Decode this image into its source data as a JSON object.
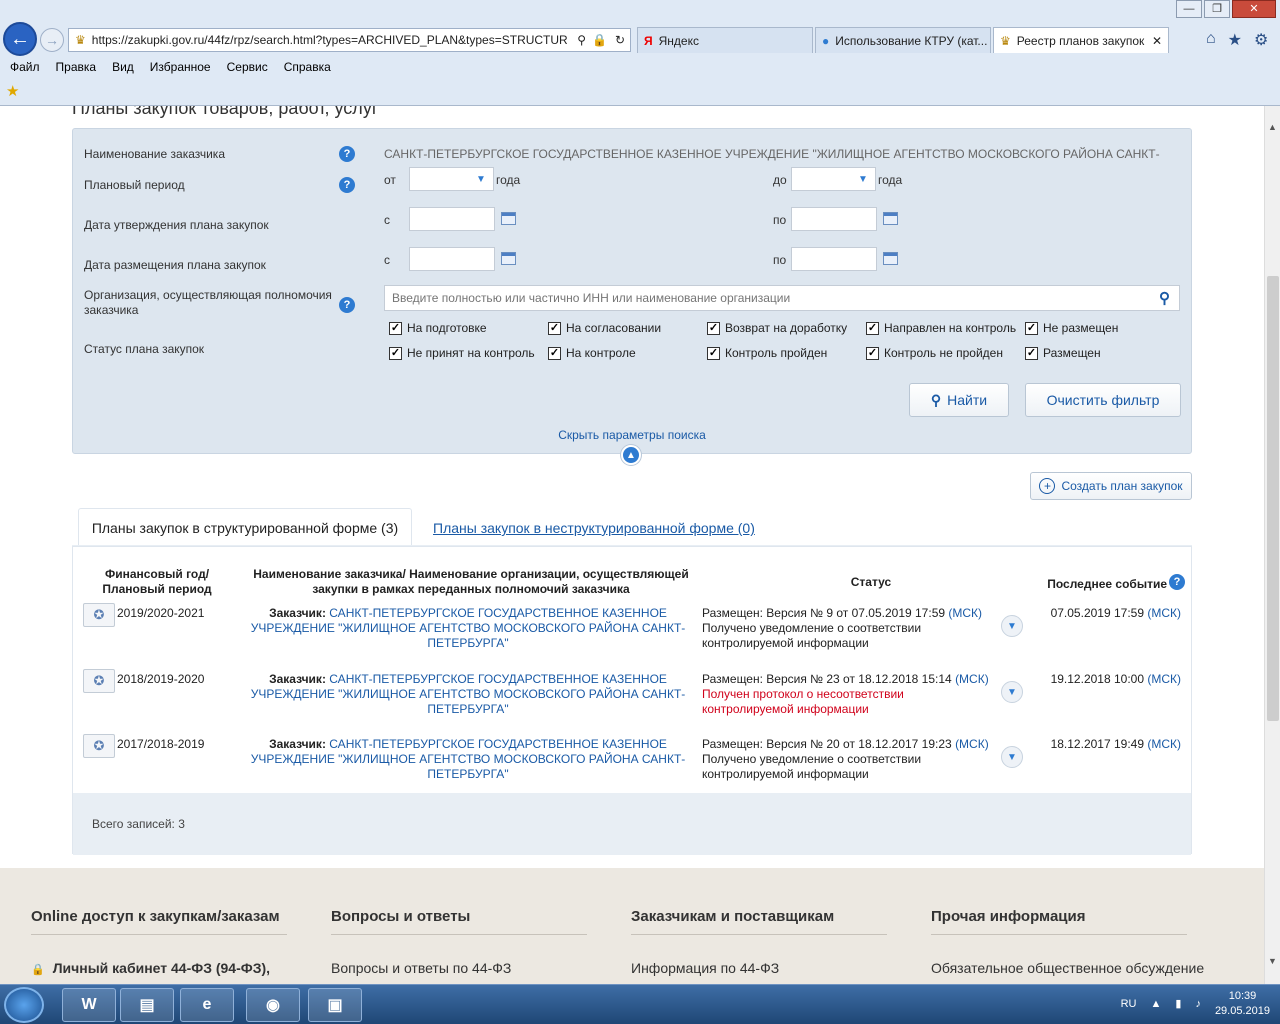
{
  "browser": {
    "url": "https://zakupki.gov.ru/44fz/rpz/search.html?types=ARCHIVED_PLAN&types=STRUCTUR",
    "tabs": [
      {
        "label": "Яндекс"
      },
      {
        "label": "Использование КТРУ (кат..."
      },
      {
        "label": "Реестр планов закупок"
      }
    ],
    "menu": [
      "Файл",
      "Правка",
      "Вид",
      "Избранное",
      "Сервис",
      "Справка"
    ]
  },
  "page": {
    "heading": "Планы закупок товаров, работ, услуг"
  },
  "filter": {
    "customer_label": "Наименование заказчика",
    "customer_value": "САНКТ-ПЕТЕРБУРГСКОЕ ГОСУДАРСТВЕННОЕ КАЗЕННОЕ УЧРЕЖДЕНИЕ \"ЖИЛИЩНОЕ АГЕНТСТВО МОСКОВСКОГО РАЙОНА САНКТ-",
    "period_label": "Плановый период",
    "from_word": "от",
    "to_word": "до",
    "year_word": "года",
    "approval_label": "Дата утверждения плана закупок",
    "posting_label": "Дата размещения плана закупок",
    "c_word": "с",
    "po_word": "по",
    "org_label": "Организация, осуществляющая полномочия заказчика",
    "org_placeholder": "Введите полностью или частично ИНН или наименование организации",
    "status_label": "Статус плана закупок",
    "statuses": [
      "На подготовке",
      "На согласовании",
      "Возврат на доработку",
      "Направлен на контроль",
      "Не размещен",
      "Не принят на контроль",
      "На контроле",
      "Контроль пройден",
      "Контроль не пройден",
      "Размещен"
    ],
    "find_button": "Найти",
    "clear_button": "Очистить фильтр",
    "hide_link": "Скрыть параметры поиска"
  },
  "create_plan": "Создать план закупок",
  "tabs": {
    "structured": "Планы закупок в структурированной форме (3)",
    "unstructured": "Планы закупок в неструктурированной форме (0)"
  },
  "table": {
    "headers": {
      "year": "Финансовый год/ Плановый период",
      "customer": "Наименование заказчика/ Наименование организации, осуществляющей закупки в рамках переданных полномочий заказчика",
      "status": "Статус",
      "last_event": "Последнее событие"
    },
    "customer_prefix": "Заказчик:",
    "rows": [
      {
        "year": "2019/2020-2021",
        "customer": "САНКТ-ПЕТЕРБУРГСКОЕ ГОСУДАРСТВЕННОЕ КАЗЕННОЕ УЧРЕЖДЕНИЕ \"ЖИЛИЩНОЕ АГЕНТСТВО МОСКОВСКОГО РАЙОНА САНКТ-ПЕТЕРБУРГА\"",
        "status_main": "Размещен: Версия № 9 от 07.05.2019 17:59",
        "status_note": "Получено уведомление о соответствии контролируемой информации",
        "note_color": "#222222",
        "last_event": "07.05.2019 17:59"
      },
      {
        "year": "2018/2019-2020",
        "customer": "САНКТ-ПЕТЕРБУРГСКОЕ ГОСУДАРСТВЕННОЕ КАЗЕННОЕ УЧРЕЖДЕНИЕ \"ЖИЛИЩНОЕ АГЕНТСТВО МОСКОВСКОГО РАЙОНА САНКТ-ПЕТЕРБУРГА\"",
        "status_main": "Размещен: Версия № 23 от 18.12.2018 15:14",
        "status_note": "Получен протокол о несоответствии контролируемой информации",
        "note_color": "#d0021b",
        "last_event": "19.12.2018 10:00"
      },
      {
        "year": "2017/2018-2019",
        "customer": "САНКТ-ПЕТЕРБУРГСКОЕ ГОСУДАРСТВЕННОЕ КАЗЕННОЕ УЧРЕЖДЕНИЕ \"ЖИЛИЩНОЕ АГЕНТСТВО МОСКОВСКОГО РАЙОНА САНКТ-ПЕТЕРБУРГА\"",
        "status_main": "Размещен: Версия № 20 от 18.12.2017 19:23",
        "status_note": "Получено уведомление о соответствии контролируемой информации",
        "note_color": "#222222",
        "last_event": "18.12.2017 19:49"
      }
    ],
    "msk": "(МСК)",
    "total": "Всего записей: 3"
  },
  "footer": {
    "columns": [
      {
        "title": "Online доступ к закупкам/заказам",
        "item": "Личный кабинет 44-ФЗ (94-ФЗ),"
      },
      {
        "title": "Вопросы и ответы",
        "item": "Вопросы и ответы по 44-ФЗ"
      },
      {
        "title": "Заказчикам и поставщикам",
        "item": "Информация по 44-ФЗ"
      },
      {
        "title": "Прочая информация",
        "item": "Обязательное общественное обсуждение"
      }
    ]
  },
  "taskbar": {
    "lang": "RU",
    "time": "10:39",
    "date": "29.05.2019"
  },
  "colors": {
    "accent": "#1a5aa6",
    "filter_bg": "#dde6ef",
    "error": "#d0021b"
  }
}
